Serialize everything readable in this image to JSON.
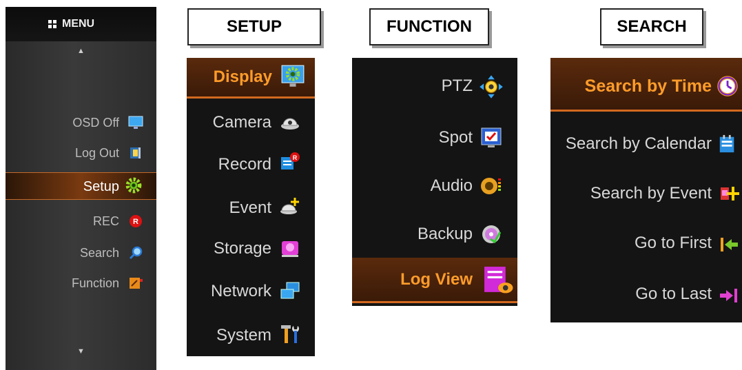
{
  "menu": {
    "title": "MENU",
    "items": [
      {
        "label": "OSD Off",
        "icon": "monitor-icon"
      },
      {
        "label": "Log Out",
        "icon": "logout-icon"
      },
      {
        "label": "Setup",
        "icon": "gear-icon",
        "selected": true
      },
      {
        "label": "REC",
        "icon": "record-icon"
      },
      {
        "label": "Search",
        "icon": "magnifier-icon"
      },
      {
        "label": "Function",
        "icon": "function-icon"
      }
    ]
  },
  "setup": {
    "title": "SETUP",
    "items": [
      {
        "label": "Display",
        "icon": "display-gear-icon",
        "selected": true
      },
      {
        "label": "Camera",
        "icon": "dome-camera-icon"
      },
      {
        "label": "Record",
        "icon": "record-schedule-icon"
      },
      {
        "label": "Event",
        "icon": "event-camera-icon"
      },
      {
        "label": "Storage",
        "icon": "storage-icon"
      },
      {
        "label": "Network",
        "icon": "network-icon"
      },
      {
        "label": "System",
        "icon": "tools-icon"
      }
    ]
  },
  "function": {
    "title": "FUNCTION",
    "items": [
      {
        "label": "PTZ",
        "icon": "ptz-icon"
      },
      {
        "label": "Spot",
        "icon": "spot-icon"
      },
      {
        "label": "Audio",
        "icon": "speaker-icon"
      },
      {
        "label": "Backup",
        "icon": "disc-icon"
      },
      {
        "label": "Log View",
        "icon": "log-view-icon",
        "selected": true
      }
    ]
  },
  "search": {
    "title": "SEARCH",
    "items": [
      {
        "label": "Search by Time",
        "icon": "clock-icon",
        "selected": true
      },
      {
        "label": "Search by Calendar",
        "icon": "calendar-icon"
      },
      {
        "label": "Search by Event",
        "icon": "event-search-icon"
      },
      {
        "label": "Go to First",
        "icon": "go-first-icon"
      },
      {
        "label": "Go to Last",
        "icon": "go-last-icon"
      }
    ]
  },
  "colors": {
    "accent": "#ff9c2a",
    "selected_bg": "#7a3a10",
    "panel_bg": "#141414",
    "text": "#d8d8d8"
  }
}
